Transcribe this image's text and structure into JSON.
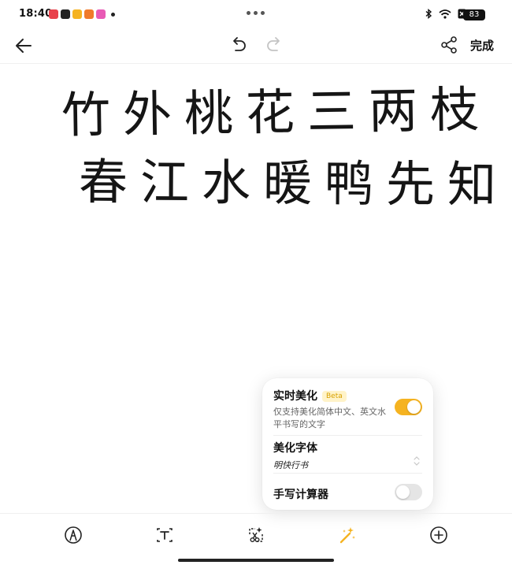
{
  "status_bar": {
    "time": "18:40",
    "battery": "83",
    "notification_icons": [
      "app-icon-red",
      "app-icon-dark",
      "app-icon-yellow",
      "app-icon-orange",
      "app-icon-pink"
    ],
    "system_icons": [
      "bluetooth-icon",
      "wifi-icon",
      "no-sim-icon",
      "battery-icon"
    ]
  },
  "toolbar": {
    "done_label": "完成",
    "icons": [
      "back-arrow-icon",
      "undo-icon",
      "redo-icon",
      "share-icon"
    ]
  },
  "handwriting": {
    "line1": "竹外桃花三两枝",
    "line2": "春江水暖鸭先知"
  },
  "popup": {
    "realtime": {
      "title": "实时美化",
      "badge": "Beta",
      "description": "仅支持美化简体中文、英文水平书写的文字",
      "enabled": true
    },
    "font": {
      "title": "美化字体",
      "value": "明快行书"
    },
    "calculator": {
      "title": "手写计算器",
      "enabled": false
    }
  },
  "bottom_toolbar": {
    "tools": [
      "pen-tool-icon",
      "text-box-icon",
      "lasso-select-icon",
      "beautify-magic-icon",
      "add-icon"
    ],
    "active_tool": "beautify-magic-icon"
  },
  "colors": {
    "accent": "#f5b321",
    "toggle_off": "#e5e5e5"
  }
}
